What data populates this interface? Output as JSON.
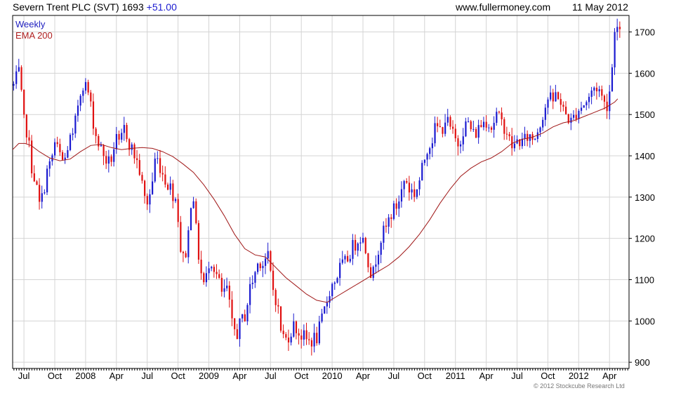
{
  "header": {
    "title_prefix": "Severn Trent PLC (SVT) 1693",
    "change": "+51.00",
    "website": "www.fullermoney.com",
    "date": "11 May 2012"
  },
  "footer": {
    "copyright": "© 2012 Stockcube Research Ltd"
  },
  "colors": {
    "up": "#1a1ad0",
    "down": "#e01010",
    "ema": "#a01818",
    "grid": "#d4d4d4"
  },
  "chart_data": {
    "type": "line",
    "legend": [
      "Weekly",
      "EMA 200"
    ],
    "legend_placement": "top-left",
    "grid": true,
    "ylim": [
      885,
      1740
    ],
    "yticks": [
      900,
      1000,
      1100,
      1200,
      1300,
      1400,
      1500,
      1600,
      1700
    ],
    "x_tick_labels": [
      "Jul",
      "Oct",
      "2008",
      "Apr",
      "Jul",
      "Oct",
      "2009",
      "Apr",
      "Jul",
      "Oct",
      "2010",
      "Apr",
      "Jul",
      "Oct",
      "2011",
      "Apr",
      "Jul",
      "Oct",
      "2012",
      "Apr"
    ],
    "x_tick_positions": [
      0.5,
      3.5,
      6.5,
      9.5,
      12.5,
      15.5,
      18.5,
      21.5,
      24.5,
      27.5,
      30.5,
      33.5,
      36.5,
      39.5,
      42.5,
      45.5,
      48.5,
      51.5,
      54.5,
      57.5
    ],
    "x_range": [
      -0.6,
      59.4
    ],
    "price_anchors": [
      [
        -0.5,
        1570
      ],
      [
        0,
        1600
      ],
      [
        0.5,
        1480
      ],
      [
        0.8,
        1460
      ],
      [
        1.2,
        1380
      ],
      [
        1.6,
        1340
      ],
      [
        2,
        1280
      ],
      [
        2.3,
        1300
      ],
      [
        2.7,
        1360
      ],
      [
        3.1,
        1380
      ],
      [
        3.5,
        1430
      ],
      [
        4,
        1400
      ],
      [
        4.4,
        1380
      ],
      [
        4.9,
        1440
      ],
      [
        5.3,
        1440
      ],
      [
        5.7,
        1520
      ],
      [
        6.2,
        1580
      ],
      [
        6.7,
        1560
      ],
      [
        7.2,
        1490
      ],
      [
        7.5,
        1450
      ],
      [
        7.9,
        1420
      ],
      [
        8.3,
        1400
      ],
      [
        8.7,
        1380
      ],
      [
        9.1,
        1400
      ],
      [
        9.4,
        1440
      ],
      [
        9.8,
        1420
      ],
      [
        10.3,
        1470
      ],
      [
        10.9,
        1420
      ],
      [
        11.3,
        1400
      ],
      [
        11.8,
        1360
      ],
      [
        12.1,
        1310
      ],
      [
        12.4,
        1280
      ],
      [
        12.9,
        1320
      ],
      [
        13.3,
        1400
      ],
      [
        13.7,
        1380
      ],
      [
        14.1,
        1350
      ],
      [
        14.6,
        1330
      ],
      [
        15,
        1310
      ],
      [
        15.4,
        1290
      ],
      [
        15.7,
        1180
      ],
      [
        16,
        1150
      ],
      [
        16.4,
        1180
      ],
      [
        16.9,
        1340
      ],
      [
        17.3,
        1200
      ],
      [
        17.7,
        1120
      ],
      [
        18.1,
        1080
      ],
      [
        18.6,
        1160
      ],
      [
        19,
        1130
      ],
      [
        19.4,
        1100
      ],
      [
        19.8,
        1060
      ],
      [
        20.3,
        1080
      ],
      [
        20.7,
        990
      ],
      [
        21.2,
        970
      ],
      [
        21.7,
        1000
      ],
      [
        22.1,
        1020
      ],
      [
        22.4,
        1070
      ],
      [
        22.9,
        1110
      ],
      [
        23.4,
        1150
      ],
      [
        23.8,
        1140
      ],
      [
        24.2,
        1160
      ],
      [
        24.7,
        1080
      ],
      [
        25.1,
        1050
      ],
      [
        25.5,
        980
      ],
      [
        25.9,
        950
      ],
      [
        26.3,
        970
      ],
      [
        26.8,
        990
      ],
      [
        27.3,
        970
      ],
      [
        27.7,
        960
      ],
      [
        28.1,
        950
      ],
      [
        28.6,
        955
      ],
      [
        29,
        960
      ],
      [
        29.4,
        990
      ],
      [
        29.9,
        1040
      ],
      [
        30.3,
        1080
      ],
      [
        30.8,
        1100
      ],
      [
        31.3,
        1130
      ],
      [
        31.8,
        1140
      ],
      [
        32.3,
        1170
      ],
      [
        32.8,
        1190
      ],
      [
        33.2,
        1210
      ],
      [
        33.6,
        1190
      ],
      [
        34.1,
        1140
      ],
      [
        34.4,
        1100
      ],
      [
        34.8,
        1160
      ],
      [
        35.2,
        1200
      ],
      [
        35.7,
        1220
      ],
      [
        36.2,
        1260
      ],
      [
        36.6,
        1270
      ],
      [
        37.1,
        1300
      ],
      [
        37.6,
        1350
      ],
      [
        38,
        1320
      ],
      [
        38.5,
        1310
      ],
      [
        38.9,
        1330
      ],
      [
        39.3,
        1370
      ],
      [
        39.7,
        1420
      ],
      [
        40.2,
        1440
      ],
      [
        40.6,
        1470
      ],
      [
        41.1,
        1460
      ],
      [
        41.5,
        1490
      ],
      [
        41.9,
        1470
      ],
      [
        42.4,
        1440
      ],
      [
        42.8,
        1430
      ],
      [
        43.3,
        1470
      ],
      [
        43.8,
        1480
      ],
      [
        44.2,
        1450
      ],
      [
        44.6,
        1460
      ],
      [
        45.1,
        1480
      ],
      [
        45.6,
        1490
      ],
      [
        46,
        1470
      ],
      [
        46.5,
        1500
      ],
      [
        46.9,
        1480
      ],
      [
        47.4,
        1470
      ],
      [
        47.8,
        1430
      ],
      [
        48.2,
        1420
      ],
      [
        48.6,
        1440
      ],
      [
        49.1,
        1430
      ],
      [
        49.6,
        1450
      ],
      [
        50.1,
        1440
      ],
      [
        50.6,
        1470
      ],
      [
        51.1,
        1510
      ],
      [
        51.5,
        1540
      ],
      [
        52,
        1530
      ],
      [
        52.4,
        1560
      ],
      [
        52.9,
        1510
      ],
      [
        53.3,
        1500
      ],
      [
        53.8,
        1480
      ],
      [
        54.3,
        1510
      ],
      [
        54.7,
        1520
      ],
      [
        55.2,
        1530
      ],
      [
        55.7,
        1550
      ],
      [
        56.1,
        1570
      ],
      [
        56.5,
        1560
      ],
      [
        56.9,
        1530
      ],
      [
        57.2,
        1520
      ],
      [
        57.5,
        1560
      ],
      [
        57.7,
        1580
      ],
      [
        57.9,
        1720
      ],
      [
        58.2,
        1710
      ],
      [
        58.5,
        1690
      ],
      [
        58.7,
        1680
      ]
    ],
    "ema_anchors": [
      [
        -0.6,
        1415
      ],
      [
        0,
        1430
      ],
      [
        0.6,
        1430
      ],
      [
        1.2,
        1425
      ],
      [
        2,
        1410
      ],
      [
        3,
        1395
      ],
      [
        4,
        1388
      ],
      [
        5,
        1392
      ],
      [
        6,
        1410
      ],
      [
        7,
        1425
      ],
      [
        8,
        1428
      ],
      [
        9,
        1420
      ],
      [
        10,
        1415
      ],
      [
        11,
        1418
      ],
      [
        12,
        1420
      ],
      [
        13,
        1418
      ],
      [
        14,
        1410
      ],
      [
        15,
        1398
      ],
      [
        16,
        1380
      ],
      [
        17,
        1360
      ],
      [
        18,
        1330
      ],
      [
        19,
        1295
      ],
      [
        20,
        1255
      ],
      [
        21,
        1210
      ],
      [
        22,
        1175
      ],
      [
        23,
        1160
      ],
      [
        24,
        1155
      ],
      [
        25,
        1130
      ],
      [
        26,
        1105
      ],
      [
        27,
        1085
      ],
      [
        28,
        1065
      ],
      [
        29,
        1050
      ],
      [
        30,
        1045
      ],
      [
        31,
        1060
      ],
      [
        32,
        1075
      ],
      [
        33,
        1090
      ],
      [
        34,
        1105
      ],
      [
        35,
        1120
      ],
      [
        36,
        1135
      ],
      [
        37,
        1155
      ],
      [
        38,
        1180
      ],
      [
        39,
        1210
      ],
      [
        40,
        1245
      ],
      [
        41,
        1285
      ],
      [
        42,
        1320
      ],
      [
        43,
        1350
      ],
      [
        44,
        1370
      ],
      [
        45,
        1385
      ],
      [
        46,
        1395
      ],
      [
        47,
        1410
      ],
      [
        48,
        1430
      ],
      [
        49,
        1440
      ],
      [
        50,
        1445
      ],
      [
        51,
        1455
      ],
      [
        52,
        1470
      ],
      [
        53,
        1480
      ],
      [
        54,
        1485
      ],
      [
        55,
        1495
      ],
      [
        56,
        1505
      ],
      [
        57,
        1515
      ],
      [
        58,
        1530
      ],
      [
        58.3,
        1538
      ]
    ]
  }
}
